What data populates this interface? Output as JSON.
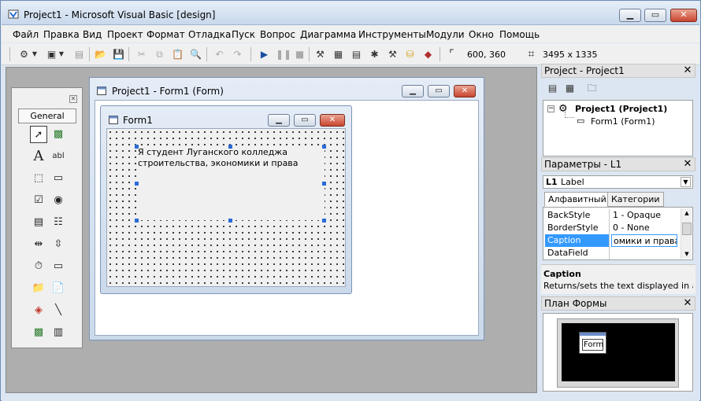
{
  "app": {
    "title": "Project1 - Microsoft Visual Basic [design]"
  },
  "menu": [
    "Файл",
    "Правка",
    "Вид",
    "Проект",
    "Формат",
    "Отладка",
    "Пуск",
    "Вопрос",
    "Диаграмма",
    "Инструменты",
    "Модули",
    "Окно",
    "Помощь"
  ],
  "toolbar": {
    "position": "600, 360",
    "size": "3495 x 1335"
  },
  "toolbox": {
    "tab": "General"
  },
  "project_window": {
    "title": "Project1 - Form1 (Form)"
  },
  "form": {
    "title": "Form1",
    "label_text": "Я студент Луганского колледжа строительства, экономики и права"
  },
  "project_panel": {
    "title": "Project - Project1",
    "root": "Project1 (Project1)",
    "child": "Form1 (Form1)"
  },
  "properties": {
    "title": "Параметры - L1",
    "object_name": "L1",
    "object_type": "Label",
    "tabs": [
      "Алфавитный",
      "Категории"
    ],
    "rows": [
      {
        "name": "BackStyle",
        "value": "1 - Opaque"
      },
      {
        "name": "BorderStyle",
        "value": "0 - None"
      },
      {
        "name": "Caption",
        "value": "омики и права"
      },
      {
        "name": "DataField",
        "value": ""
      }
    ],
    "desc_title": "Caption",
    "desc_text": "Returns/sets the text displayed in an"
  },
  "layout_panel": {
    "title": "План Формы",
    "form_label": "Form"
  }
}
